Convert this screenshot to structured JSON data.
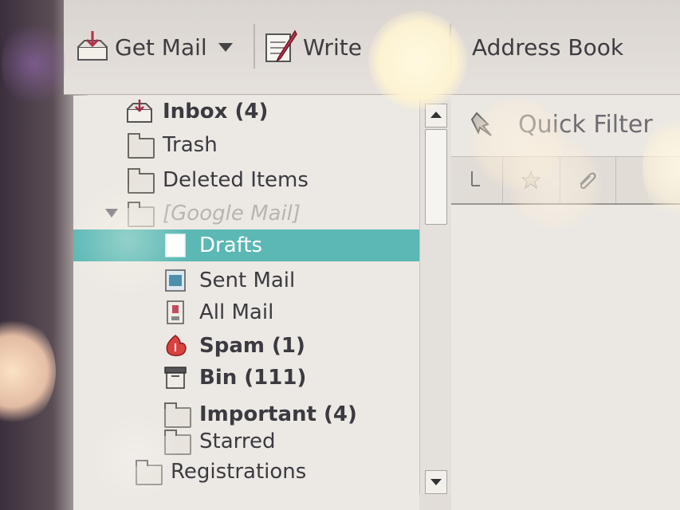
{
  "toolbar": {
    "get_mail_label": "Get Mail",
    "write_label": "Write",
    "address_book_label": "Address Book"
  },
  "folders": [
    {
      "label": "Inbox (4)",
      "icon": "inbox-icon",
      "bold": true
    },
    {
      "label": "Trash",
      "icon": "folder-icon",
      "bold": false
    },
    {
      "label": "Deleted Items",
      "icon": "folder-icon",
      "bold": false
    },
    {
      "label": "[Google Mail]",
      "icon": "folder-icon",
      "bold": false
    },
    {
      "label": "Drafts",
      "icon": "drafts-icon",
      "bold": false,
      "selected": true
    },
    {
      "label": "Sent Mail",
      "icon": "sent-icon",
      "bold": false
    },
    {
      "label": "All Mail",
      "icon": "archive-icon",
      "bold": false
    },
    {
      "label": "Spam (1)",
      "icon": "spam-icon",
      "bold": true
    },
    {
      "label": "Bin (111)",
      "icon": "bin-icon",
      "bold": true
    },
    {
      "label": "Important (4)",
      "icon": "folder-icon",
      "bold": true
    },
    {
      "label": "Starred",
      "icon": "folder-icon",
      "bold": false
    },
    {
      "label": "Registrations",
      "icon": "folder-icon",
      "bold": false
    }
  ],
  "message_pane": {
    "quick_filter_label": "Quick Filter"
  },
  "colors": {
    "selection": "#5bb8b5",
    "text": "#3c3a40"
  }
}
